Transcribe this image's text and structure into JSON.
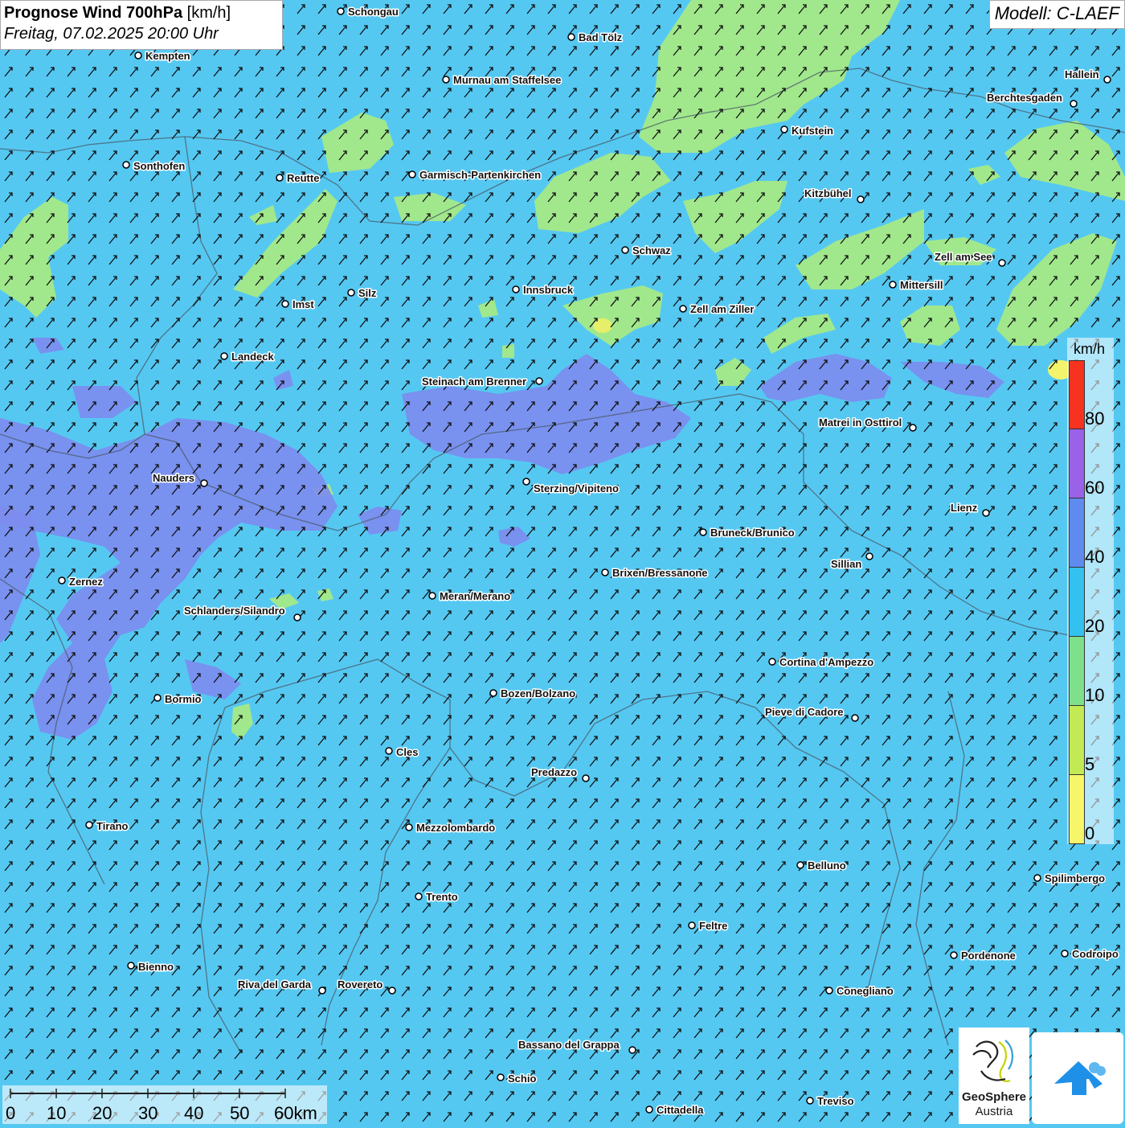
{
  "header": {
    "title_bold": "Prognose Wind 700hPa",
    "title_unit": "[km/h]",
    "datetime": "Freitag, 07.02.2025 20:00 Uhr",
    "model": "Modell: C-LAEF"
  },
  "legend": {
    "unit": "km/h",
    "segments": [
      {
        "color": "#f7331f"
      },
      {
        "color": "#9a62e6"
      },
      {
        "color": "#5f8bef"
      },
      {
        "color": "#33c2f0"
      },
      {
        "color": "#7ee08a"
      },
      {
        "color": "#c2ea55"
      },
      {
        "color": "#f7f56a"
      }
    ],
    "ticks": [
      "80",
      "60",
      "40",
      "20",
      "10",
      "5",
      "0"
    ]
  },
  "scale_bar": {
    "labels": [
      "0",
      "10",
      "20",
      "30",
      "40",
      "50",
      "60km"
    ]
  },
  "logos": {
    "geosphere_line1": "GeoSphere",
    "geosphere_line2": "Austria"
  },
  "colors": {
    "background_wind": "#55c8f2",
    "light_wind": "#a5ea86",
    "strong_wind": "#7d8cef",
    "arrow": "#111111"
  },
  "cities": [
    {
      "name": "Schongau"
    },
    {
      "name": "Bad Tölz"
    },
    {
      "name": "Kempten"
    },
    {
      "name": "Murnau am Staffelsee"
    },
    {
      "name": "Hallein"
    },
    {
      "name": "Berchtesgaden"
    },
    {
      "name": "Kufstein"
    },
    {
      "name": "Sonthofen"
    },
    {
      "name": "Reutte"
    },
    {
      "name": "Garmisch-Partenkirchen"
    },
    {
      "name": "Kitzbühel"
    },
    {
      "name": "Schwaz"
    },
    {
      "name": "Zell am See"
    },
    {
      "name": "Mittersill"
    },
    {
      "name": "Innsbruck"
    },
    {
      "name": "Silz"
    },
    {
      "name": "Imst"
    },
    {
      "name": "Zell am Ziller"
    },
    {
      "name": "Landeck"
    },
    {
      "name": "Steinach am Brenner"
    },
    {
      "name": "Matrei in Osttirol"
    },
    {
      "name": "Nauders"
    },
    {
      "name": "Sterzing/Vipiteno"
    },
    {
      "name": "Lienz"
    },
    {
      "name": "Bruneck/Brunico"
    },
    {
      "name": "Sillian"
    },
    {
      "name": "Brixen/Bressanone"
    },
    {
      "name": "Zernez"
    },
    {
      "name": "Meran/Merano"
    },
    {
      "name": "Schlanders/Silandro"
    },
    {
      "name": "Cortina d'Ampezzo"
    },
    {
      "name": "Bormio"
    },
    {
      "name": "Bozen/Bolzano"
    },
    {
      "name": "Pieve di Cadore"
    },
    {
      "name": "Cles"
    },
    {
      "name": "Predazzo"
    },
    {
      "name": "Tirano"
    },
    {
      "name": "Mezzolombardo"
    },
    {
      "name": "Belluno"
    },
    {
      "name": "Spilimbergo"
    },
    {
      "name": "Trento"
    },
    {
      "name": "Feltre"
    },
    {
      "name": "Pordenone"
    },
    {
      "name": "Codroipo"
    },
    {
      "name": "Bienno"
    },
    {
      "name": "Riva del Garda"
    },
    {
      "name": "Rovereto"
    },
    {
      "name": "Conegliano"
    },
    {
      "name": "Bassano del Grappa"
    },
    {
      "name": "Schio"
    },
    {
      "name": "Treviso"
    },
    {
      "name": "Cittadella"
    }
  ]
}
